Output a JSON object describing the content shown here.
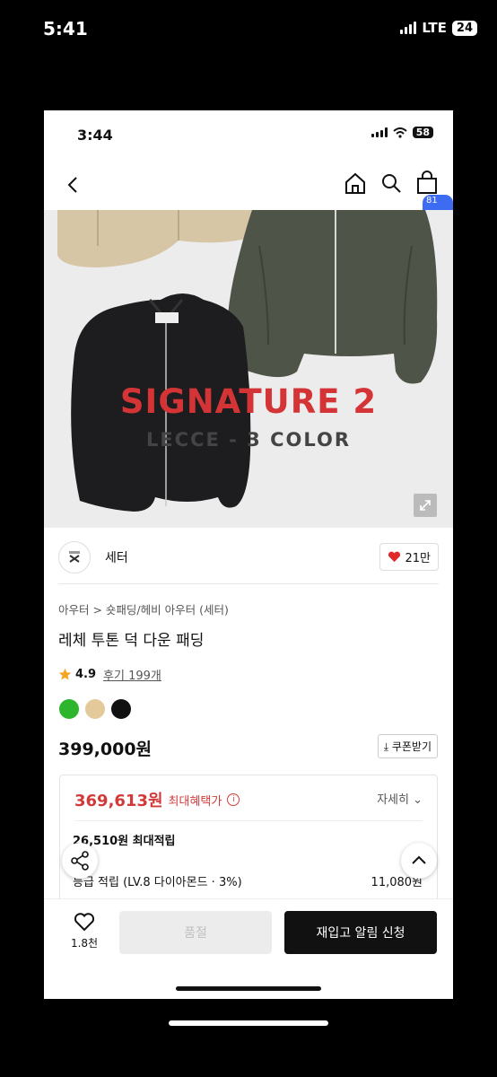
{
  "outer_status": {
    "time": "5:41",
    "network": "LTE",
    "battery": "24"
  },
  "inner_status": {
    "time": "3:44",
    "battery": "58"
  },
  "nav": {
    "cart_count": "81"
  },
  "hero": {
    "title": "SIGNATURE 2",
    "subtitle": "LECCE - 3 COLOR"
  },
  "brand": {
    "name": "세터",
    "likes": "21만"
  },
  "product": {
    "breadcrumb": "아우터 > 숏패딩/헤비 아우터 (세터)",
    "title": "레체 투톤 덕 다운 패딩",
    "rating": "4.9",
    "reviews": "후기 199개",
    "colors": [
      "#2db52d",
      "#e4c99a",
      "#111111"
    ],
    "price": "399,000원",
    "coupon_label": "쿠폰받기"
  },
  "benefit": {
    "max_price": "369,613원",
    "max_label": "최대혜택가",
    "detail_label": "자세히",
    "points": "26,510원 최대적립",
    "grade_label": "등급 적립 (LV.8 다이아몬드 · 3%)",
    "grade_value": "11,080원"
  },
  "bottom": {
    "wish_count": "1.8천",
    "gray_button": "품절",
    "black_button": "재입고 알림 신청"
  },
  "colors": {
    "accent_red": "#d23a3a",
    "badge_blue": "#3d6bf2"
  }
}
